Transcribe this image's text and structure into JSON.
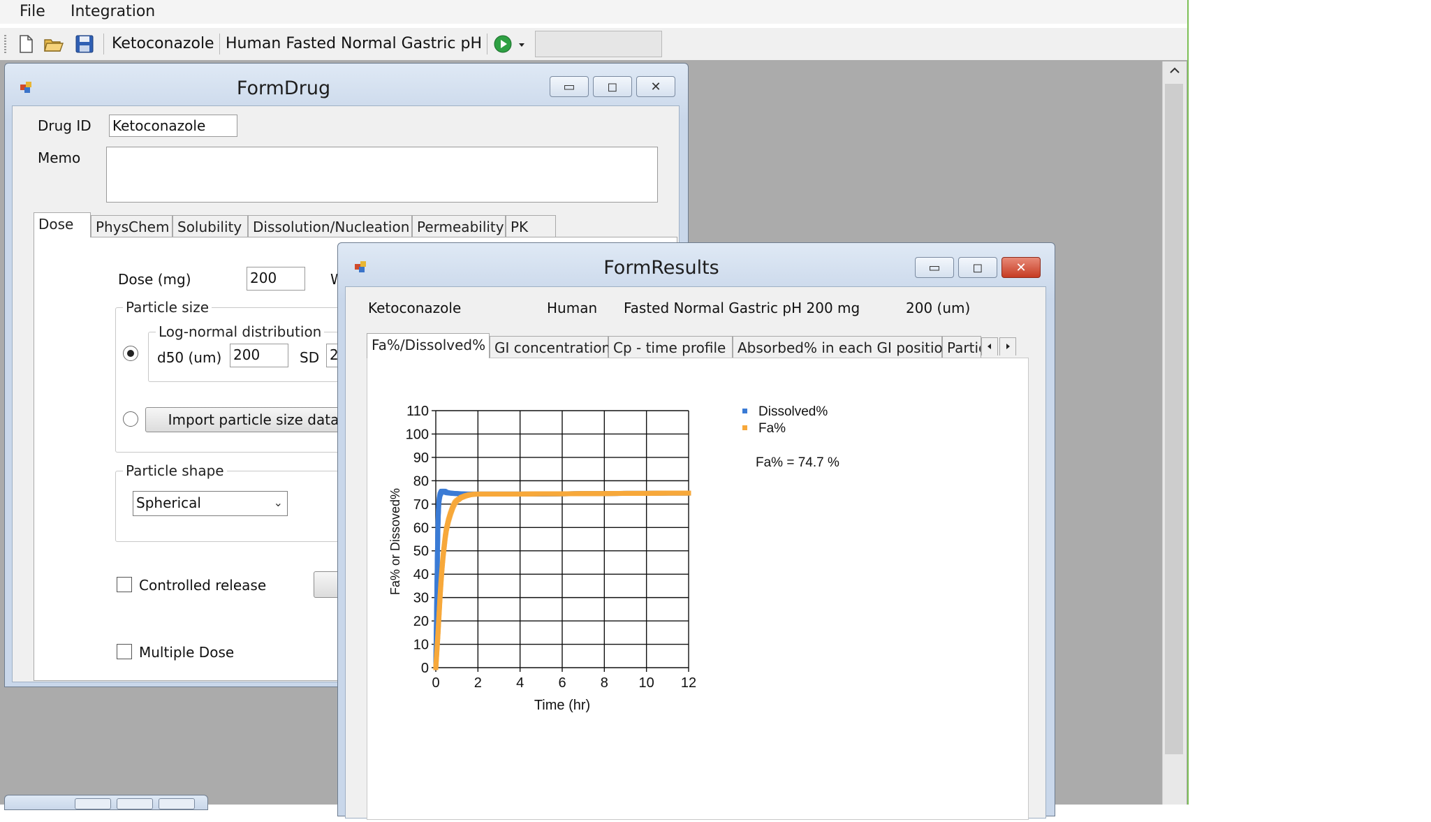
{
  "menu": {
    "file": "File",
    "integration": "Integration"
  },
  "toolbar": {
    "drug": "Ketoconazole",
    "condition": "Human Fasted Normal Gastric pH",
    "icons": [
      "new-file-icon",
      "open-folder-icon",
      "save-disk-icon",
      "run-play-icon",
      "dropdown-arrow-icon"
    ]
  },
  "form_drug": {
    "title": "FormDrug",
    "drug_id_label": "Drug ID",
    "drug_id_value": "Ketoconazole",
    "memo_label": "Memo",
    "memo_value": "",
    "tabs": [
      "Dose",
      "PhysChem",
      "Solubility",
      "Dissolution/Nucleation",
      "Permeability",
      "PK"
    ],
    "active_tab": "Dose",
    "dose_label": "Dose (mg)",
    "dose_value": "200",
    "clipped_label": "W",
    "particle_size_group": "Particle size",
    "lognormal_group": "Log-normal distribution",
    "d50_label": "d50 (um)",
    "d50_value": "200",
    "sd_label": "SD",
    "sd_value": "2",
    "import_button": "Import particle size data",
    "particle_shape_group": "Particle shape",
    "particle_shape_value": "Spherical",
    "controlled_release": "Controlled release",
    "multiple_dose": "Multiple Dose"
  },
  "form_results": {
    "title": "FormResults",
    "info": {
      "drug": "Ketoconazole",
      "species": "Human",
      "condition": "Fasted Normal Gastric pH 200 mg",
      "particle": "200 (um)"
    },
    "tabs": [
      "Fa%/Dissolved%",
      "GI concentration",
      "Cp - time profile",
      "Absorbed% in each GI position",
      "Partic"
    ],
    "active_tab": "Fa%/Dissolved%",
    "fa_text": "Fa% = 74.7 %"
  },
  "colors": {
    "dissolved": "#3a7bd5",
    "fa": "#f7a83a",
    "close_button": "#c63b22"
  },
  "chart_data": {
    "type": "scatter",
    "title": "",
    "xlabel": "Time (hr)",
    "ylabel": "Fa% or Dissoved%",
    "xlim": [
      0,
      12
    ],
    "ylim": [
      0,
      110
    ],
    "xticks": [
      "0",
      "2",
      "4",
      "6",
      "8",
      "10",
      "12"
    ],
    "yticks": [
      "0",
      "10",
      "20",
      "30",
      "40",
      "50",
      "60",
      "70",
      "80",
      "90",
      "100",
      "110"
    ],
    "grid": true,
    "legend_position": "top-right",
    "series": [
      {
        "name": "Dissolved%",
        "x": [
          0,
          0.02,
          0.04,
          0.06,
          0.08,
          0.1,
          0.12,
          0.14,
          0.16,
          0.2,
          0.25,
          0.3,
          0.4,
          0.5,
          0.6,
          0.8,
          1.0,
          1.2,
          1.5,
          2,
          3,
          4,
          5,
          6,
          7,
          8,
          9,
          10,
          11,
          12
        ],
        "y": [
          0,
          12,
          25,
          38,
          50,
          60,
          66,
          70,
          72,
          74,
          75,
          75.5,
          75.5,
          75,
          74.8,
          74.6,
          74.5,
          74.4,
          74.3,
          74.3,
          74.3,
          74.3,
          74.3,
          74.4,
          74.5,
          74.5,
          74.6,
          74.6,
          74.7,
          74.7
        ]
      },
      {
        "name": "Fa%",
        "x": [
          0,
          0.05,
          0.1,
          0.15,
          0.2,
          0.25,
          0.3,
          0.35,
          0.4,
          0.45,
          0.5,
          0.6,
          0.7,
          0.8,
          0.9,
          1.0,
          1.2,
          1.4,
          1.6,
          1.8,
          2.0,
          2.5,
          3,
          4,
          5,
          6,
          7,
          8,
          9,
          10,
          11,
          12
        ],
        "y": [
          0,
          7,
          14,
          22,
          30,
          37,
          43,
          48,
          52,
          56,
          59,
          63,
          66,
          68.5,
          70.5,
          71.5,
          72.8,
          73.5,
          74,
          74.2,
          74.3,
          74.3,
          74.3,
          74.3,
          74.4,
          74.4,
          74.5,
          74.5,
          74.6,
          74.6,
          74.7,
          74.7
        ]
      }
    ]
  }
}
